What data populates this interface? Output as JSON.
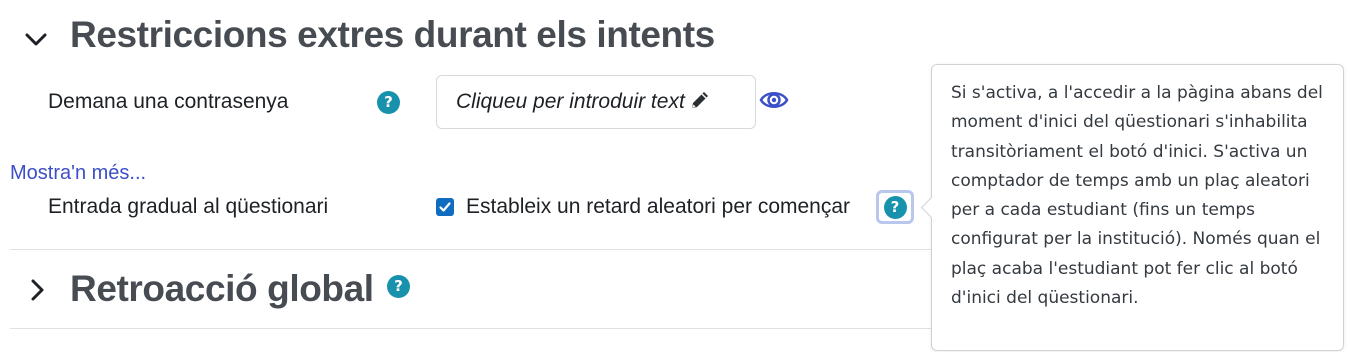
{
  "sections": {
    "restrictions": {
      "title": "Restriccions extres durant els intents",
      "expanded": true
    },
    "feedback": {
      "title": "Retroacció global",
      "expanded": false
    }
  },
  "password": {
    "label": "Demana una contrasenya",
    "placeholder": "Cliqueu per introduir text",
    "edit_icon": "pencil-icon",
    "reveal_icon": "eye-icon"
  },
  "show_more": "Mostra'n més...",
  "delay": {
    "label": "Entrada gradual al qüestionari",
    "checkbox_label": "Estableix un retard aleatori per començar",
    "checked": true
  },
  "help_icon_glyph": "?",
  "popover": {
    "text": "Si s'activa, a l'accedir a la pàgina abans del moment d'inici del qüestionari s'inhabilita transitòriament el botó d'inici. S'activa un comptador de temps amb un plaç aleatori per a cada estudiant (fins un temps configurat per la institució). Només quan el plaç acaba l'estudiant pot fer clic al botó d'inici del qüestionari."
  },
  "colors": {
    "accent": "#1891ad",
    "link": "#3c4fc8",
    "checkbox": "#0f6cbf",
    "title": "#474b52"
  }
}
